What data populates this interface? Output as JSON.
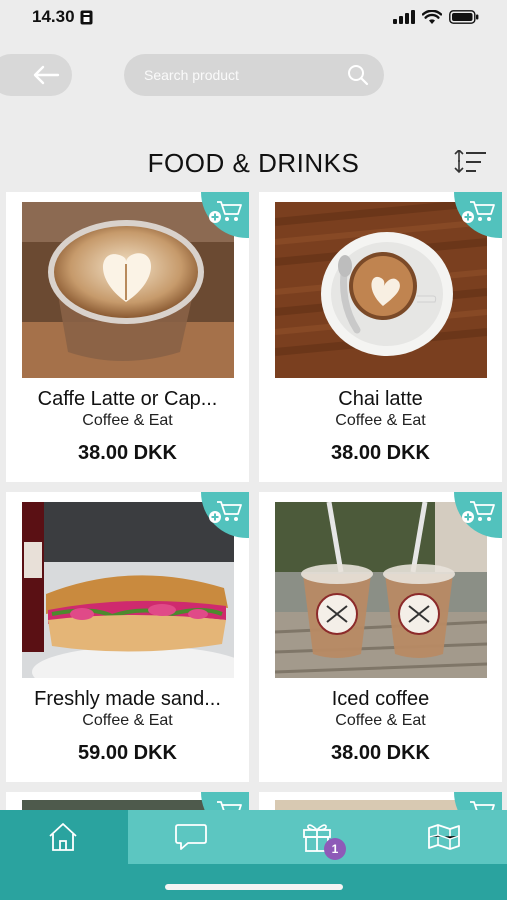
{
  "status": {
    "time": "14.30"
  },
  "header": {
    "search_placeholder": "Search product",
    "title": "FOOD & DRINKS"
  },
  "products": [
    {
      "name": "Caffe Latte or Cap...",
      "vendor": "Coffee & Eat",
      "price": "38.00 DKK",
      "photo": "latte-art-glass"
    },
    {
      "name": "Chai latte",
      "vendor": "Coffee & Eat",
      "price": "38.00 DKK",
      "photo": "cappuccino-cup-on-wood"
    },
    {
      "name": "Freshly made sand...",
      "vendor": "Coffee & Eat",
      "price": "59.00 DKK",
      "photo": "baguette-sandwich"
    },
    {
      "name": "Iced coffee",
      "vendor": "Coffee & Eat",
      "price": "38.00 DKK",
      "photo": "iced-coffee-cups"
    }
  ],
  "tabs": [
    {
      "name": "home",
      "icon": "home-icon"
    },
    {
      "name": "messages",
      "icon": "chat-bubble-icon"
    },
    {
      "name": "gifts",
      "icon": "gift-icon",
      "badge": "1"
    },
    {
      "name": "map",
      "icon": "map-icon"
    }
  ],
  "colors": {
    "accent": "#52c2bd",
    "tab_bar": "#2aa39f",
    "tab_active": "#5cc6c1",
    "badge": "#8e5ab8"
  }
}
